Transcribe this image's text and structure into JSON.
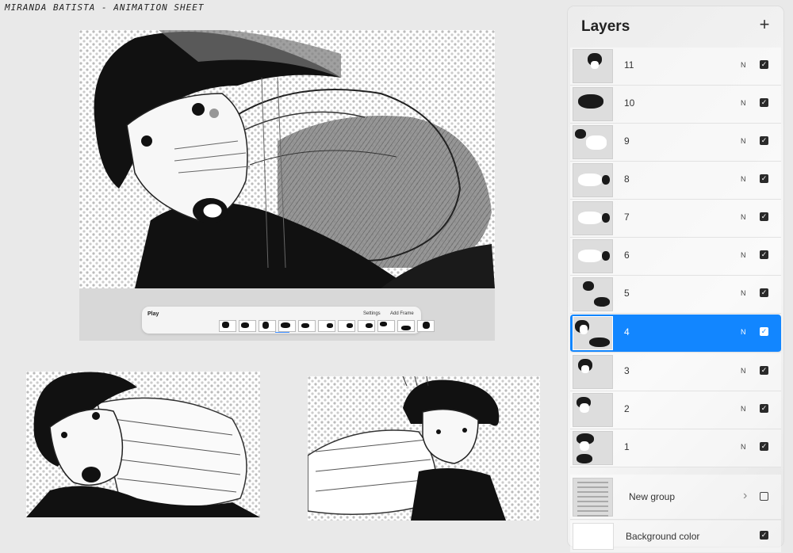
{
  "sheet_title": "MIRANDA BATISTA  -  ANIMATION SHEET",
  "timeline": {
    "play_label": "Play",
    "settings_label": "Settings",
    "add_frame_label": "Add Frame",
    "frame_count": 11
  },
  "layers_panel": {
    "title": "Layers",
    "add_icon": "plus-icon",
    "layers": [
      {
        "name": "11",
        "blend": "N",
        "visible": true,
        "selected": false
      },
      {
        "name": "10",
        "blend": "N",
        "visible": true,
        "selected": false
      },
      {
        "name": "9",
        "blend": "N",
        "visible": true,
        "selected": false
      },
      {
        "name": "8",
        "blend": "N",
        "visible": true,
        "selected": false
      },
      {
        "name": "7",
        "blend": "N",
        "visible": true,
        "selected": false
      },
      {
        "name": "6",
        "blend": "N",
        "visible": true,
        "selected": false
      },
      {
        "name": "5",
        "blend": "N",
        "visible": true,
        "selected": false
      },
      {
        "name": "4",
        "blend": "N",
        "visible": true,
        "selected": true
      },
      {
        "name": "3",
        "blend": "N",
        "visible": true,
        "selected": false
      },
      {
        "name": "2",
        "blend": "N",
        "visible": true,
        "selected": false
      },
      {
        "name": "1",
        "blend": "N",
        "visible": true,
        "selected": false
      }
    ],
    "group": {
      "name": "New group",
      "visible": false
    },
    "background": {
      "name": "Background color",
      "visible": true
    }
  },
  "colors": {
    "selection": "#1286ff",
    "panel_bg": "#f0f0f0",
    "page_bg": "#e9e9e9"
  }
}
